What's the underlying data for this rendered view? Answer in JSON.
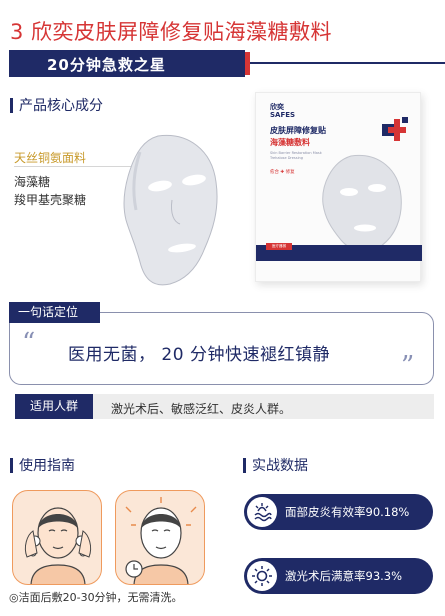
{
  "header": {
    "title": "3 欣奕皮肤屏障修复贴海藻糖敷料",
    "slogan": "20分钟急救之星"
  },
  "ingredients": {
    "heading": "产品核心成分",
    "main": "天丝铜氨面料",
    "subs": [
      "海藻糖",
      "羧甲基壳聚糖"
    ]
  },
  "product": {
    "logo_line1": "欣奕",
    "logo_line2": "SAFES",
    "name_line1": "皮肤屏障修复贴",
    "name_line2": "海藻糖敷料",
    "english": "Skin Barrier Restoration Mask Trehalose Dressing",
    "tag": "愈合 ✚ 修复",
    "band_tag": "医疗器械",
    "colors": {
      "navy": "#1f2a66",
      "red": "#d63535"
    }
  },
  "positioning": {
    "label": "一句话定位",
    "text": "医用无菌， 20 分钟快速褪红镇静"
  },
  "crowd": {
    "label": "适用人群",
    "text": "激光术后、敏感泛红、皮炎人群。"
  },
  "guide": {
    "heading": "使用指南",
    "note": "◎洁面后敷20-30分钟，无需清洗。",
    "step_icons": [
      "face-wash-icon",
      "mask-timer-icon"
    ]
  },
  "data_section": {
    "heading": "实战数据",
    "stats": [
      {
        "text": "面部皮炎有效率90.18%",
        "icon": "face-wave-icon"
      },
      {
        "text": "激光术后满意率93.3%",
        "icon": "sun-icon"
      }
    ]
  }
}
